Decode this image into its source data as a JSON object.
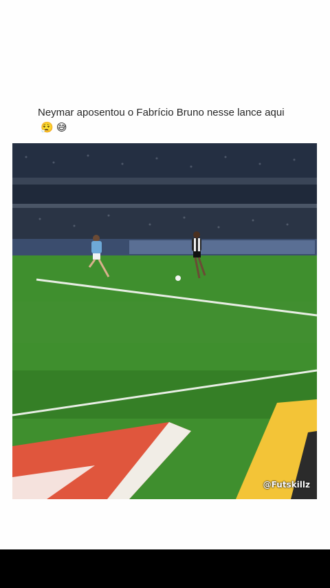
{
  "post": {
    "caption_text": "Neymar aposentou o Fabrício Bruno nesse lance aqui",
    "caption_emojis": "😮‍💨 😅"
  },
  "video": {
    "watermark": "@Futskillz"
  },
  "colors": {
    "pitch": "#3f8f2e",
    "pitch_dark": "#357f26",
    "stands": "#1b2535",
    "ad_board_red": "#e0563d",
    "ad_board_yellow": "#f3c437",
    "bottom_bar": "#000000"
  }
}
